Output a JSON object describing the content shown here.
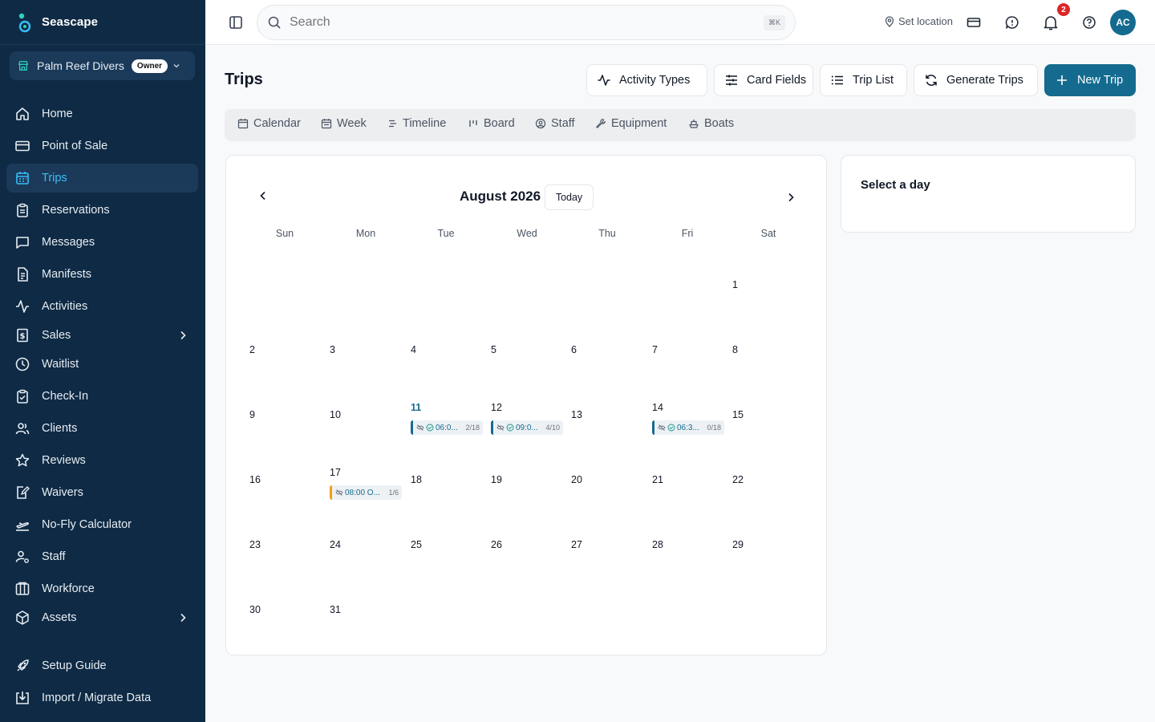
{
  "app": {
    "name": "Seascape"
  },
  "org": {
    "name": "Palm Reef Divers",
    "role": "Owner"
  },
  "nav": [
    {
      "label": "Home",
      "icon": "home-icon"
    },
    {
      "label": "Point of Sale",
      "icon": "credit-card-icon"
    },
    {
      "label": "Trips",
      "icon": "calendar-icon",
      "active": true
    },
    {
      "label": "Reservations",
      "icon": "clipboard-icon"
    },
    {
      "label": "Messages",
      "icon": "message-icon"
    },
    {
      "label": "Manifests",
      "icon": "document-icon"
    },
    {
      "label": "Activities",
      "icon": "activity-icon"
    },
    {
      "label": "Sales",
      "icon": "receipt-icon",
      "expandable": true
    },
    {
      "label": "Waitlist",
      "icon": "clock-icon"
    },
    {
      "label": "Check-In",
      "icon": "clipboard-check-icon"
    },
    {
      "label": "Clients",
      "icon": "users-icon"
    },
    {
      "label": "Reviews",
      "icon": "star-icon"
    },
    {
      "label": "Waivers",
      "icon": "file-signature-icon"
    },
    {
      "label": "No-Fly Calculator",
      "icon": "plane-off-icon"
    },
    {
      "label": "Staff",
      "icon": "user-cog-icon"
    },
    {
      "label": "Workforce",
      "icon": "columns-icon"
    },
    {
      "label": "Assets",
      "icon": "box-icon",
      "expandable": true
    },
    {
      "label": "Setup Guide",
      "icon": "rocket-icon"
    },
    {
      "label": "Import / Migrate Data",
      "icon": "import-icon"
    }
  ],
  "topbar": {
    "search_placeholder": "Search",
    "shortcut": "⌘K",
    "location_label": "Set location",
    "notification_count": "2",
    "avatar_initials": "AC"
  },
  "page": {
    "title": "Trips",
    "actions": {
      "activity_types": "Activity Types",
      "card_fields": "Card Fields",
      "trip_list": "Trip List",
      "generate_trips": "Generate Trips",
      "new_trip": "New Trip"
    },
    "views": [
      "Calendar",
      "Week",
      "Timeline",
      "Board",
      "Staff",
      "Equipment",
      "Boats"
    ]
  },
  "calendar": {
    "month_label": "August 2026",
    "today_label": "Today",
    "weekdays": [
      "Sun",
      "Mon",
      "Tue",
      "Wed",
      "Thu",
      "Fri",
      "Sat"
    ],
    "weeks": [
      [
        "",
        "",
        "",
        "",
        "",
        "",
        "1"
      ],
      [
        "2",
        "3",
        "4",
        "5",
        "6",
        "7",
        "8"
      ],
      [
        "9",
        "10",
        "11",
        "12",
        "13",
        "14",
        "15"
      ],
      [
        "16",
        "17",
        "18",
        "19",
        "20",
        "21",
        "22"
      ],
      [
        "23",
        "24",
        "25",
        "26",
        "27",
        "28",
        "29"
      ],
      [
        "30",
        "31",
        "",
        "",
        "",
        "",
        ""
      ]
    ],
    "highlighted_day": "11",
    "trips": [
      {
        "week": 2,
        "day": 2,
        "label": "06:0...",
        "count": "2/18",
        "status": "teal"
      },
      {
        "week": 2,
        "day": 3,
        "label": "09:0...",
        "count": "4/10",
        "status": "teal"
      },
      {
        "week": 2,
        "day": 5,
        "label": "06:3...",
        "count": "0/18",
        "status": "teal"
      },
      {
        "week": 3,
        "day": 1,
        "label": "08:00 O...",
        "count": "1/6",
        "status": "orange"
      }
    ]
  },
  "day_panel": {
    "title": "Select a day"
  }
}
